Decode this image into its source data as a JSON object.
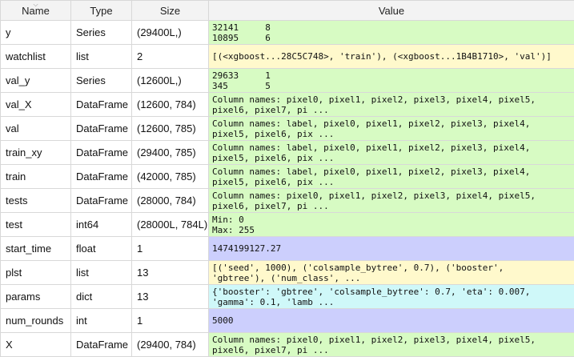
{
  "header": {
    "name": "Name",
    "type": "Type",
    "size": "Size",
    "value": "Value"
  },
  "icons": {
    "sort": "sort-chevron-down-icon"
  },
  "colors": {
    "green": "#d7fbc3",
    "yellow": "#fff9cc",
    "purple": "#cccffd",
    "cyan": "#cff8f9"
  },
  "rows": [
    {
      "name": "y",
      "type": "Series",
      "size": "(29400L,)",
      "value": "32141     8\n10895     6",
      "color": "green"
    },
    {
      "name": "watchlist",
      "type": "list",
      "size": "2",
      "value": "[(<xgboost...28C5C748>, 'train'), (<xgboost...1B4B1710>, 'val')]",
      "color": "yellow"
    },
    {
      "name": "val_y",
      "type": "Series",
      "size": "(12600L,)",
      "value": "29633     1\n345       5",
      "color": "green"
    },
    {
      "name": "val_X",
      "type": "DataFrame",
      "size": "(12600, 784)",
      "value": "Column names: pixel0, pixel1, pixel2, pixel3, pixel4, pixel5,\npixel6, pixel7, pi ...",
      "color": "green"
    },
    {
      "name": "val",
      "type": "DataFrame",
      "size": "(12600, 785)",
      "value": "Column names: label, pixel0, pixel1, pixel2, pixel3, pixel4,\npixel5, pixel6, pix ...",
      "color": "green"
    },
    {
      "name": "train_xy",
      "type": "DataFrame",
      "size": "(29400, 785)",
      "value": "Column names: label, pixel0, pixel1, pixel2, pixel3, pixel4,\npixel5, pixel6, pix ...",
      "color": "green"
    },
    {
      "name": "train",
      "type": "DataFrame",
      "size": "(42000, 785)",
      "value": "Column names: label, pixel0, pixel1, pixel2, pixel3, pixel4,\npixel5, pixel6, pix ...",
      "color": "green"
    },
    {
      "name": "tests",
      "type": "DataFrame",
      "size": "(28000, 784)",
      "value": "Column names: pixel0, pixel1, pixel2, pixel3, pixel4, pixel5,\npixel6, pixel7, pi ...",
      "color": "green"
    },
    {
      "name": "test",
      "type": "int64",
      "size": "(28000L, 784L)",
      "value": "Min: 0\nMax: 255",
      "color": "green"
    },
    {
      "name": "start_time",
      "type": "float",
      "size": "1",
      "value": "1474199127.27",
      "color": "purple"
    },
    {
      "name": "plst",
      "type": "list",
      "size": "13",
      "value": "[('seed', 1000), ('colsample_bytree', 0.7), ('booster',\n'gbtree'), ('num_class', ...",
      "color": "yellow"
    },
    {
      "name": "params",
      "type": "dict",
      "size": "13",
      "value": "{'booster': 'gbtree', 'colsample_bytree': 0.7, 'eta': 0.007,\n'gamma': 0.1, 'lamb ...",
      "color": "cyan"
    },
    {
      "name": "num_rounds",
      "type": "int",
      "size": "1",
      "value": "5000",
      "color": "purple"
    },
    {
      "name": "X",
      "type": "DataFrame",
      "size": "(29400, 784)",
      "value": "Column names: pixel0, pixel1, pixel2, pixel3, pixel4, pixel5,\npixel6, pixel7, pi ...",
      "color": "green"
    }
  ]
}
